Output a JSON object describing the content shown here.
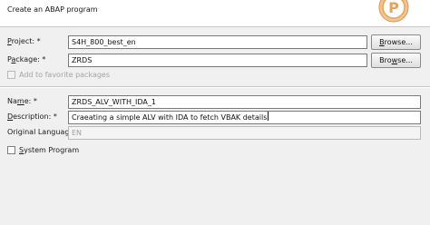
{
  "header": {
    "title": "Create an ABAP program",
    "logo_letter": "P"
  },
  "form": {
    "project": {
      "label_mnemonic": "P",
      "label_rest": "roject: *",
      "value": "S4H_800_best_en",
      "browse_label_mnemonic": "B",
      "browse_label_rest": "rowse..."
    },
    "package": {
      "label_prefix": "P",
      "label_mnemonic": "a",
      "label_rest": "ckage: *",
      "value": "ZRDS",
      "browse_label_prefix": "Bro",
      "browse_label_mnemonic": "w",
      "browse_label_rest": "se..."
    },
    "add_favorite": {
      "label": "Add to favorite packages",
      "checked": false,
      "enabled": false
    },
    "name": {
      "label_prefix": "Na",
      "label_mnemonic": "m",
      "label_rest": "e: *",
      "value": "ZRDS_ALV_WITH_IDA_1"
    },
    "description": {
      "label_mnemonic": "D",
      "label_rest": "escription: *",
      "value": "Craeating a simple ALV with IDA to fetch VBAK details"
    },
    "original_language": {
      "label": "Original Language:",
      "value": "EN"
    },
    "system_program": {
      "label_mnemonic": "S",
      "label_rest": "ystem Program",
      "checked": false
    }
  },
  "colors": {
    "dialog_background": "#f0f0f0",
    "header_background": "#ffffff",
    "logo_orange": "#e8a25a"
  }
}
